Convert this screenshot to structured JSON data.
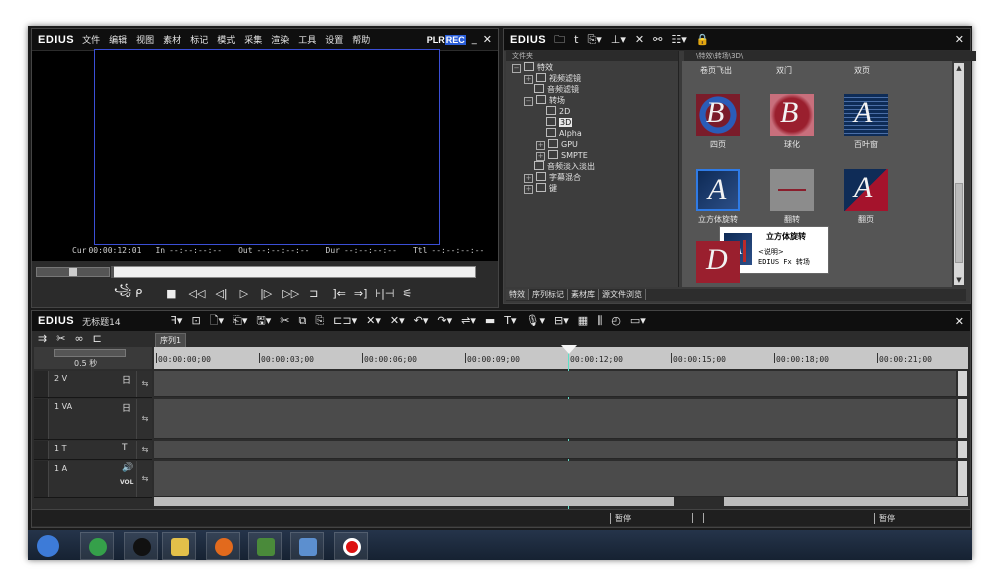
{
  "player": {
    "logo": "EDIUS",
    "menu": [
      "文件",
      "编辑",
      "视图",
      "素材",
      "标记",
      "模式",
      "采集",
      "渲染",
      "工具",
      "设置",
      "帮助"
    ],
    "plr": "PLR",
    "rec": "REC",
    "cur_label": "Cur",
    "cur_value": "00:00:12:01",
    "in_label": "In",
    "in_value": "--:--:--:--",
    "out_label": "Out",
    "out_value": "--:--:--:--",
    "dur_label": "Dur",
    "dur_value": "--:--:--:--",
    "ttl_label": "Ttl",
    "ttl_value": "--:--:--:--"
  },
  "library": {
    "logo": "EDIUS",
    "tree_header": "文件夹",
    "path": "\\特效\\转场\\3D\\",
    "tree": [
      {
        "label": "特效",
        "indent": 0,
        "expand": "−"
      },
      {
        "label": "视频滤镜",
        "indent": 1,
        "expand": "+"
      },
      {
        "label": "音频滤镜",
        "indent": 1,
        "expand": ""
      },
      {
        "label": "转场",
        "indent": 1,
        "expand": "−"
      },
      {
        "label": "2D",
        "indent": 2,
        "expand": ""
      },
      {
        "label": "3D",
        "indent": 2,
        "expand": "",
        "selected": true
      },
      {
        "label": "Alpha",
        "indent": 2,
        "expand": ""
      },
      {
        "label": "GPU",
        "indent": 2,
        "expand": "+"
      },
      {
        "label": "SMPTE",
        "indent": 2,
        "expand": "+"
      },
      {
        "label": "音频淡入淡出",
        "indent": 1,
        "expand": ""
      },
      {
        "label": "字幕混合",
        "indent": 1,
        "expand": "+"
      },
      {
        "label": "键",
        "indent": 1,
        "expand": "+"
      }
    ],
    "row1_labels": [
      "卷页飞出",
      "双门",
      "双页"
    ],
    "thumbs": [
      {
        "label": "四页",
        "glyph": "B"
      },
      {
        "label": "球化",
        "glyph": "B"
      },
      {
        "label": "百叶窗",
        "glyph": "A"
      },
      {
        "label": "立方体旋转",
        "glyph": "A"
      },
      {
        "label": "翻转",
        "glyph": ""
      },
      {
        "label": "翻页",
        "glyph": "A"
      },
      {
        "label": "",
        "glyph": "D"
      }
    ],
    "tooltip": {
      "title": "立方体旋转",
      "line1": "<说明>",
      "line2": "EDIUS Fx 转场",
      "glyph": "A"
    },
    "tabs": [
      "特效",
      "序列标记",
      "素材库",
      "源文件浏览"
    ]
  },
  "timeline": {
    "logo": "EDIUS",
    "project": "无标题14",
    "sequence_tab": "序列1",
    "zoom": "0.5 秒",
    "ruler": [
      "00:00:00;00",
      "00:00:03;00",
      "00:00:06;00",
      "00:00:09;00",
      "00:00:12;00",
      "00:00:15;00",
      "00:00:18;00",
      "00:00:21;00"
    ],
    "tracks": [
      {
        "name": "2 V",
        "right": "日"
      },
      {
        "name": "1 VA",
        "right": "日"
      },
      {
        "name": "1 T",
        "right": "T"
      },
      {
        "name": "1 A",
        "right": "🔊",
        "vol": "VOL"
      }
    ],
    "status_left": "暂停",
    "status_right": "暂停"
  },
  "taskbar": {
    "icons": [
      "windows-start",
      "360-browser",
      "qq",
      "file-explorer",
      "firefox",
      "edius-app",
      "notes-app",
      "recorder"
    ]
  }
}
